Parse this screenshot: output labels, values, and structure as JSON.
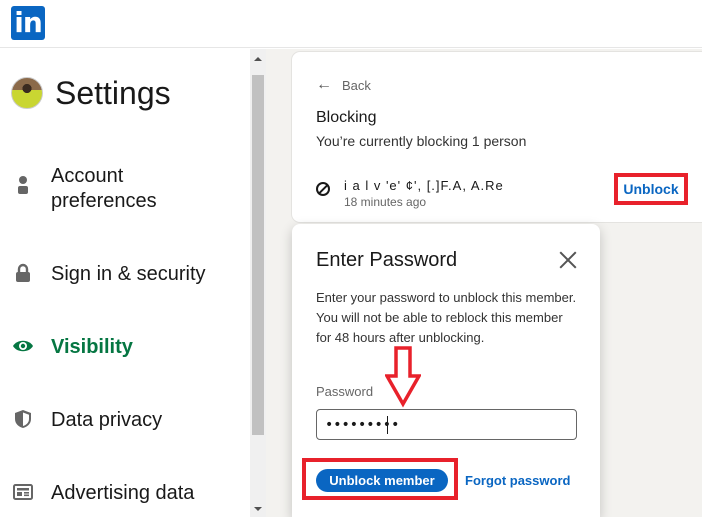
{
  "app": {
    "logo_text": "in",
    "brand_color": "#0a66c2"
  },
  "sidebar": {
    "title": "Settings",
    "items": [
      {
        "label": "Account preferences",
        "icon": "person-icon",
        "active": false
      },
      {
        "label": "Sign in & security",
        "icon": "lock-icon",
        "active": false
      },
      {
        "label": "Visibility",
        "icon": "eye-icon",
        "active": true
      },
      {
        "label": "Data privacy",
        "icon": "shield-icon",
        "active": false
      },
      {
        "label": "Advertising data",
        "icon": "ad-icon",
        "active": false
      }
    ],
    "active_color": "#057642"
  },
  "blocking": {
    "back_label": "Back",
    "title": "Blocking",
    "subtitle": "You’re currently blocking 1 person",
    "blocked_members": [
      {
        "name": "i a l v 'e' ¢', [.]F.A, A.Re",
        "time": "18 minutes ago",
        "action": "Unblock"
      }
    ]
  },
  "modal": {
    "title": "Enter Password",
    "description": "Enter your password to unblock this member. You will not be able to reblock this member for 48 hours after unblocking.",
    "password_label": "Password",
    "password_value": "•••••••••",
    "primary_button": "Unblock member",
    "secondary_link": "Forgot password"
  },
  "annotations": {
    "highlight_color": "#e8212b"
  }
}
